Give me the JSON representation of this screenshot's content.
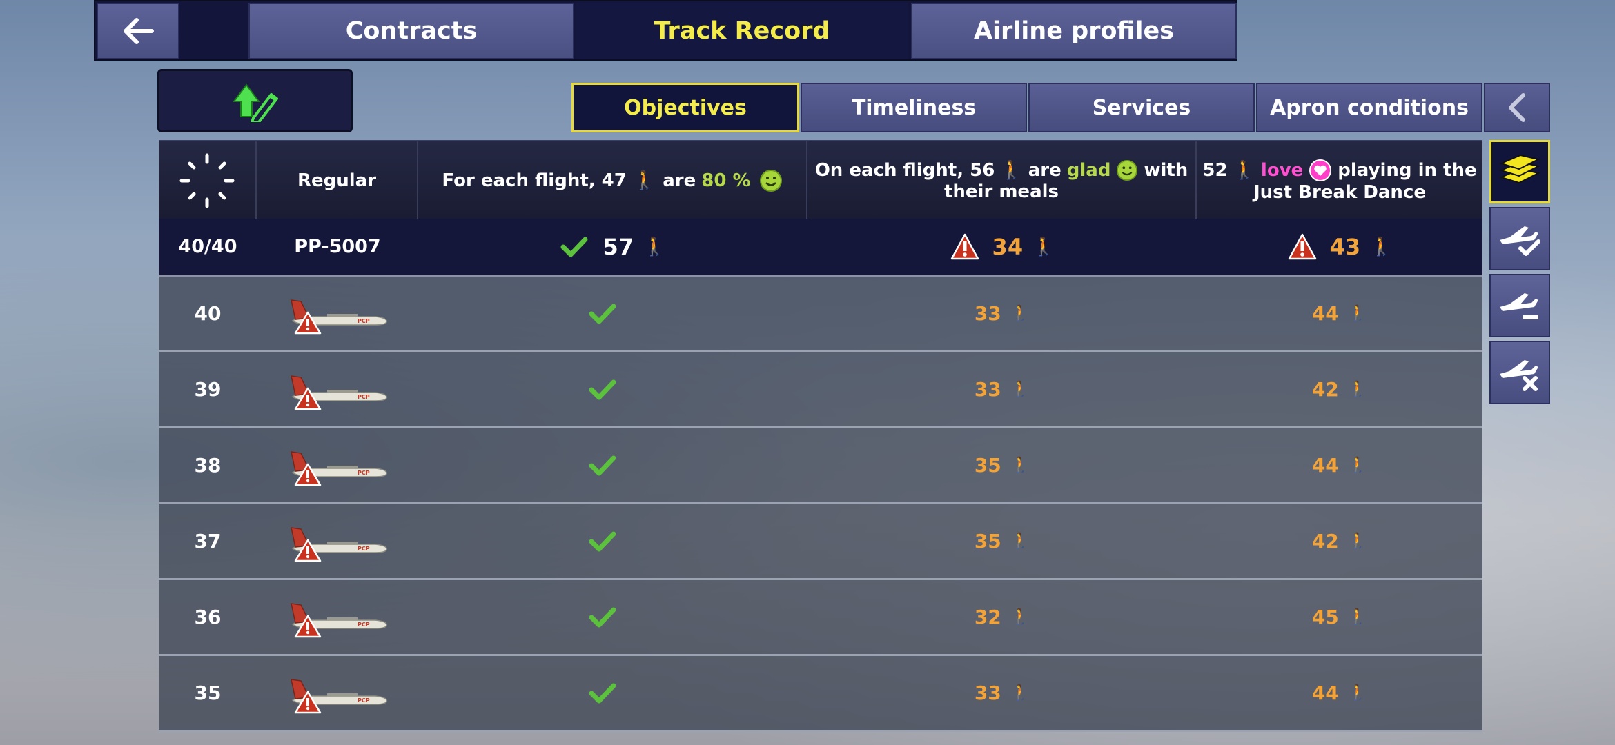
{
  "top_tabs": {
    "contracts": "Contracts",
    "track_record": "Track Record",
    "airline_profiles": "Airline profiles"
  },
  "sub_tabs": {
    "objectives": "Objectives",
    "timeliness": "Timeliness",
    "services": "Services",
    "apron": "Apron conditions"
  },
  "header": {
    "regular": "Regular",
    "obj1_prefix": "For each flight, 47",
    "obj1_are": "are",
    "obj1_percent": "80 %",
    "obj2_line1_prefix": "On each flight, 56",
    "obj2_are": "are",
    "obj2_glad": "glad",
    "obj2_with": "with",
    "obj2_line2": "their meals",
    "obj3_count": "52",
    "obj3_love": "love",
    "obj3_rest": "playing in the",
    "obj3_line2": "Just Break Dance"
  },
  "summary": {
    "count": "40/40",
    "flight": "PP-5007",
    "obj1": "57",
    "obj2": "34",
    "obj3": "43"
  },
  "rows": [
    {
      "num": "40",
      "obj2": "33",
      "obj3": "44"
    },
    {
      "num": "39",
      "obj2": "33",
      "obj3": "42"
    },
    {
      "num": "38",
      "obj2": "35",
      "obj3": "44"
    },
    {
      "num": "37",
      "obj2": "35",
      "obj3": "42"
    },
    {
      "num": "36",
      "obj2": "32",
      "obj3": "45"
    },
    {
      "num": "35",
      "obj2": "33",
      "obj3": "44"
    }
  ],
  "colors": {
    "accent_yellow": "#f4ec4b",
    "ok_green": "#5cc23e",
    "warn_orange": "#f2a33a",
    "alert_red": "#c8321e",
    "love_pink": "#ff4fd1"
  }
}
